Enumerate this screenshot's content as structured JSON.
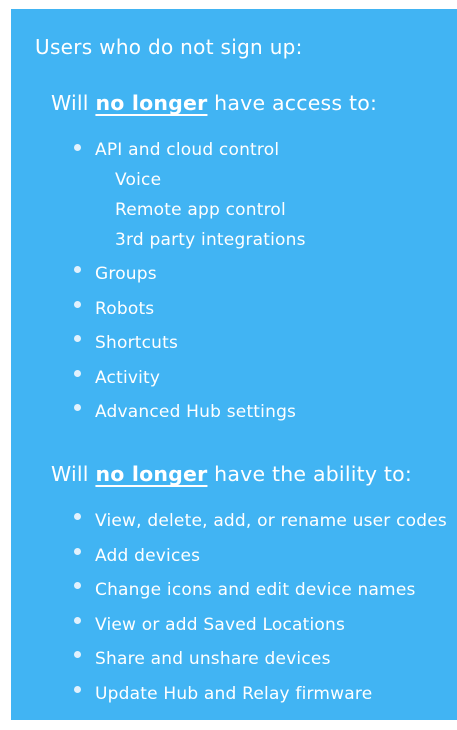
{
  "heading": "Users who do not sign up:",
  "access_section": {
    "prefix": "Will ",
    "emphasis": "no longer",
    "suffix": " have access to:",
    "first_item": {
      "label": "API and cloud control",
      "sub_items": [
        "Voice",
        "Remote app control",
        "3rd party integrations"
      ]
    },
    "items": [
      "Groups",
      "Robots",
      "Shortcuts",
      "Activity",
      "Advanced Hub settings"
    ]
  },
  "ability_section": {
    "prefix": "Will ",
    "emphasis": "no longer",
    "suffix": " have the ability to:",
    "items": [
      "View, delete, add, or rename user codes",
      "Add devices",
      "Change icons and edit device names",
      "View or add Saved Locations",
      "Share and unshare devices",
      "Update Hub and Relay firmware"
    ]
  },
  "colors": {
    "background": "#41b4f3",
    "text": "#ffffff",
    "bullet": "#e1f1fd"
  }
}
